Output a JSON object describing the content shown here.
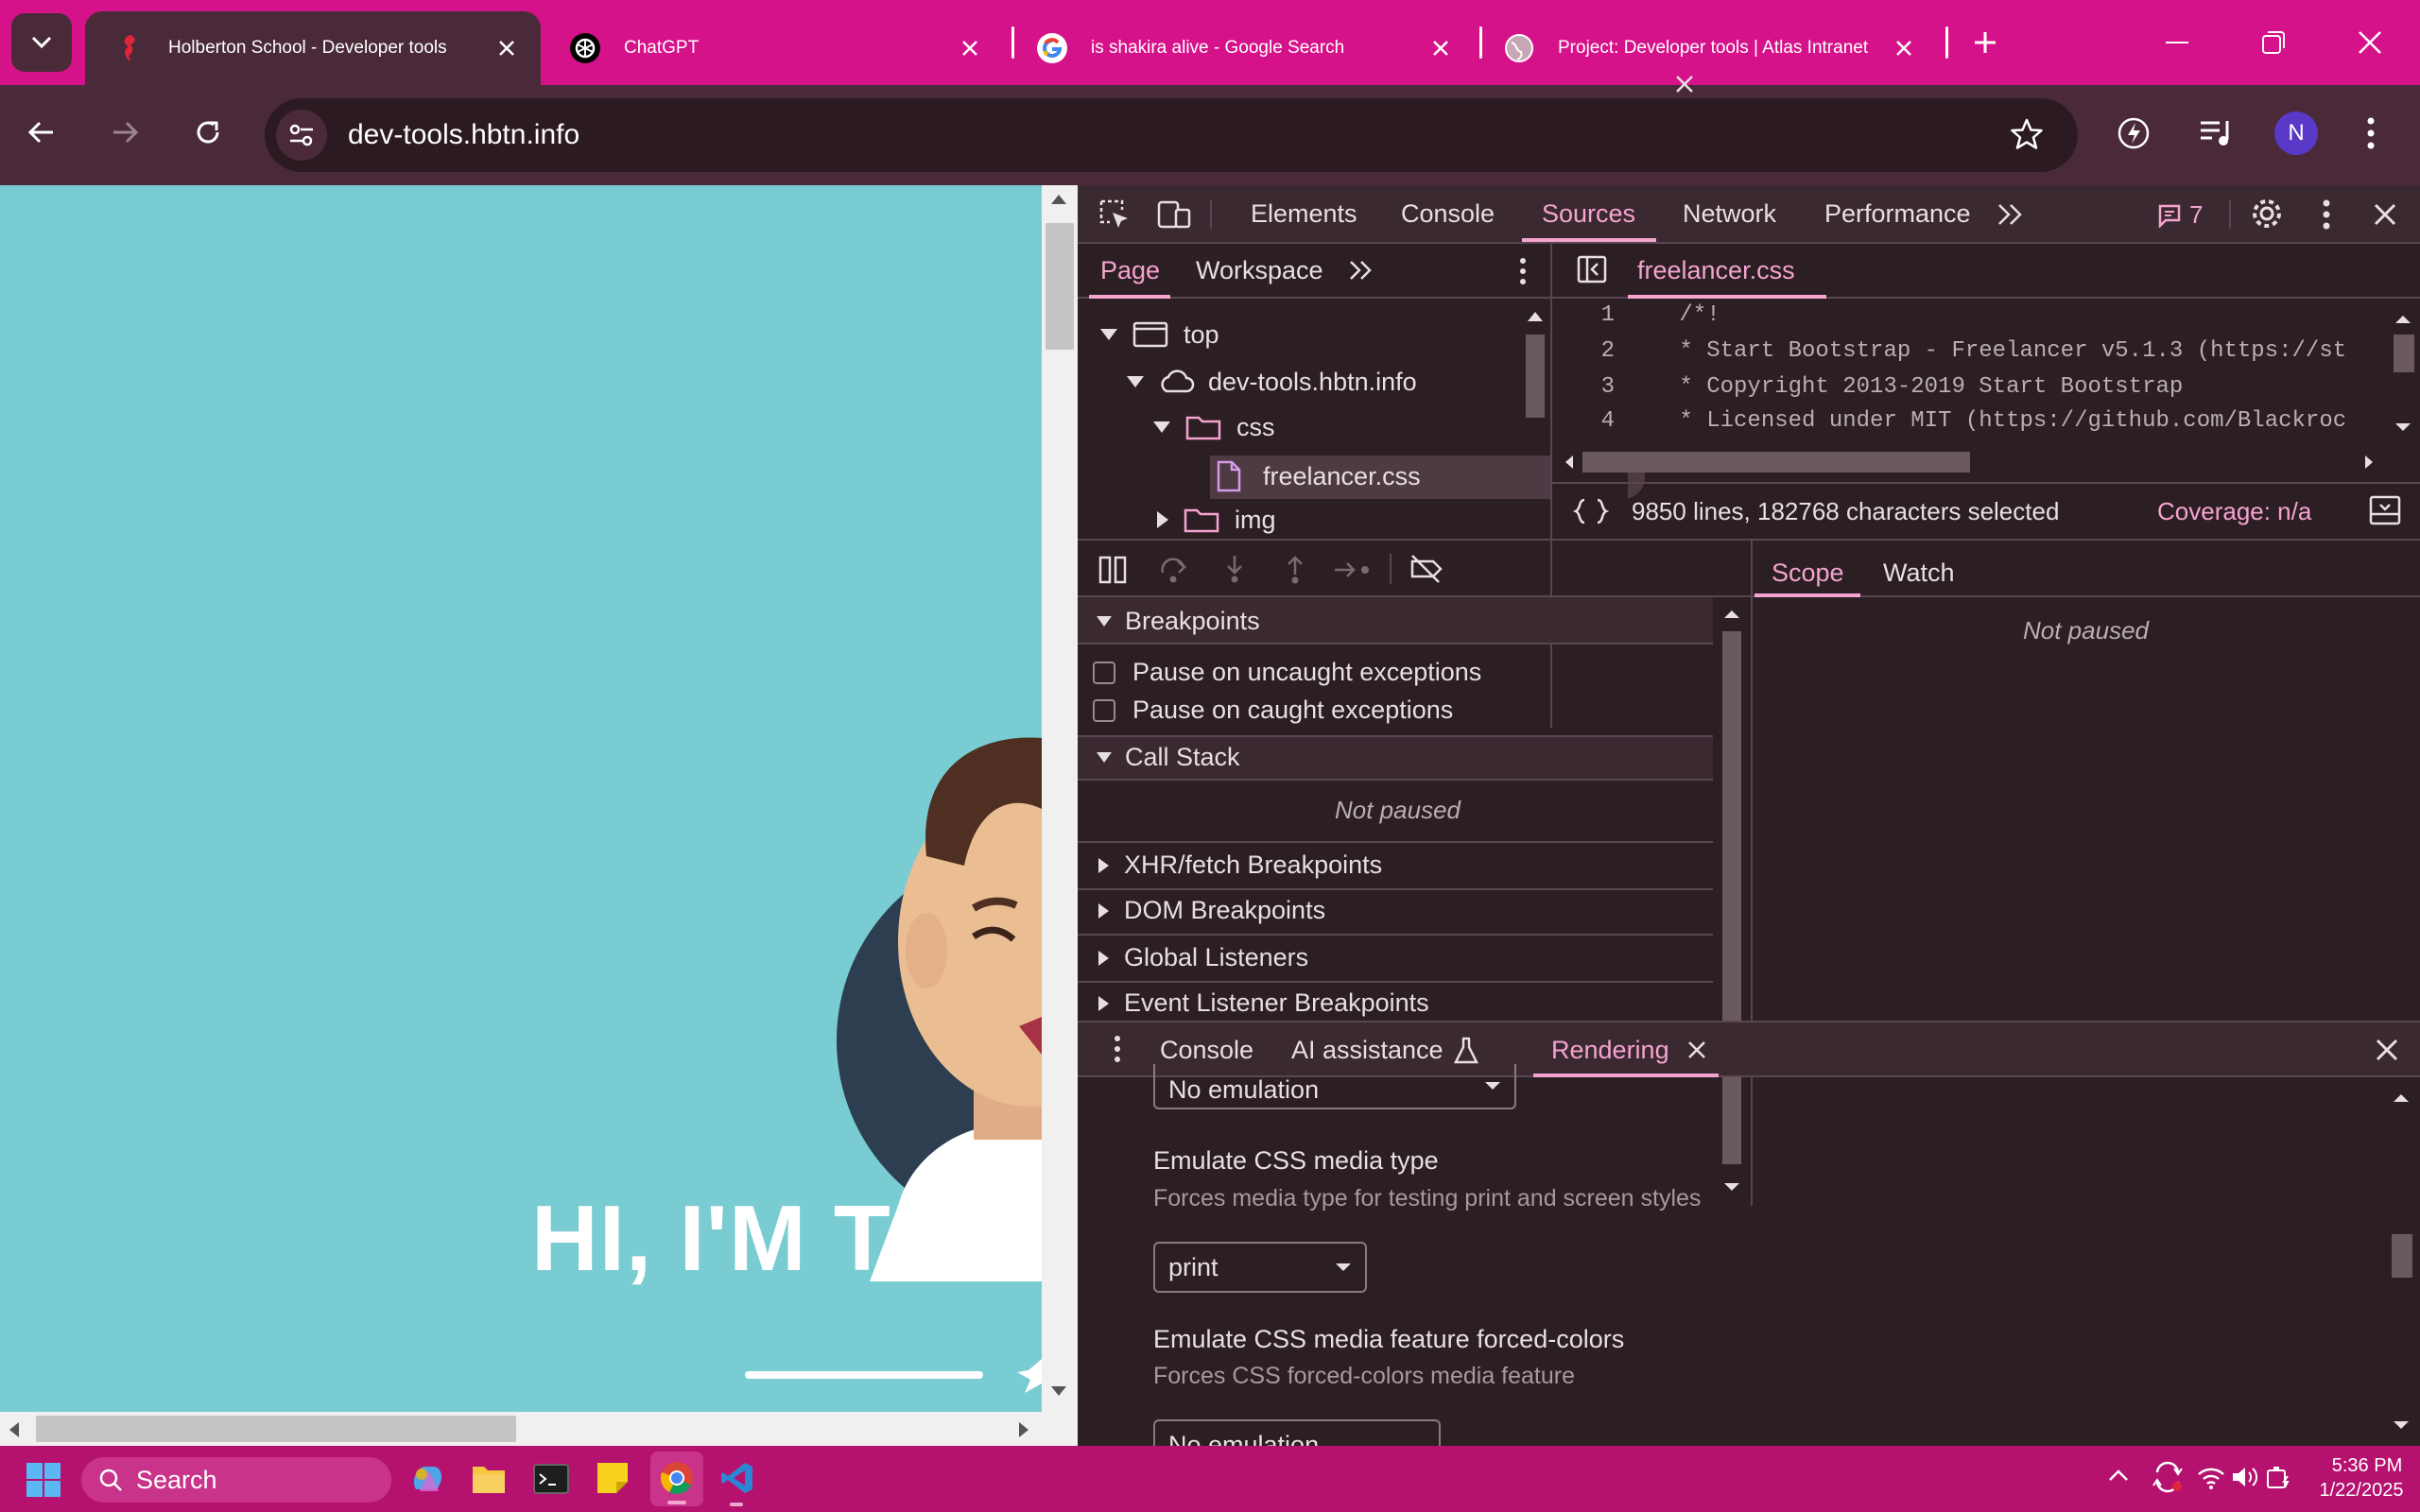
{
  "browser": {
    "tabs": [
      {
        "title": "Holberton School - Developer tools",
        "active": true,
        "icon": "seahorse-icon"
      },
      {
        "title": "ChatGPT",
        "active": false,
        "icon": "chatgpt-icon"
      },
      {
        "title": "is shakira alive - Google Search",
        "active": false,
        "icon": "google-icon"
      },
      {
        "title": "Project: Developer tools | Atlas Intranet",
        "active": false,
        "icon": "globe-icon"
      }
    ],
    "url": "dev-tools.hbtn.info",
    "profile_initial": "N",
    "accent": "#d6128a"
  },
  "page": {
    "headline": "HI, I'M THE"
  },
  "devtools": {
    "main_tabs": [
      "Elements",
      "Console",
      "Sources",
      "Network",
      "Performance"
    ],
    "active_main_tab": "Sources",
    "issues_count": "7",
    "navigator_tabs": [
      "Page",
      "Workspace"
    ],
    "tree": {
      "top": "top",
      "domain": "dev-tools.hbtn.info",
      "folder_css": "css",
      "file": "freelancer.css",
      "folder_img": "img"
    },
    "editor": {
      "file_tab": "freelancer.css",
      "lines": [
        {
          "num": "1",
          "text": "/*!"
        },
        {
          "num": "2",
          "text": " * Start Bootstrap - Freelancer v5.1.3 (https://st"
        },
        {
          "num": "3",
          "text": " * Copyright 2013-2019 Start Bootstrap"
        },
        {
          "num": "4",
          "text": " * Licensed under MIT (https://github.com/Blackroc"
        }
      ],
      "status": "9850 lines, 182768 characters selected",
      "coverage": "Coverage: n/a"
    },
    "debugger": {
      "breakpoints_title": "Breakpoints",
      "pause_uncaught": "Pause on uncaught exceptions",
      "pause_caught": "Pause on caught exceptions",
      "call_stack_title": "Call Stack",
      "not_paused": "Not paused",
      "sections": [
        "XHR/fetch Breakpoints",
        "DOM Breakpoints",
        "Global Listeners",
        "Event Listener Breakpoints"
      ]
    },
    "scope_tabs": [
      "Scope",
      "Watch"
    ],
    "scope_status": "Not paused",
    "drawer": {
      "tabs": [
        "Console",
        "AI assistance",
        "Rendering"
      ],
      "active": "Rendering",
      "top_select": "No emulation",
      "media_type_label": "Emulate CSS media type",
      "media_type_desc": "Forces media type for testing print and screen styles",
      "media_type_value": "print",
      "forced_colors_label": "Emulate CSS media feature forced-colors",
      "forced_colors_desc": "Forces CSS forced-colors media feature",
      "forced_colors_value": "No emulation"
    }
  },
  "taskbar": {
    "search_placeholder": "Search",
    "time": "5:36 PM",
    "date": "1/22/2025"
  }
}
